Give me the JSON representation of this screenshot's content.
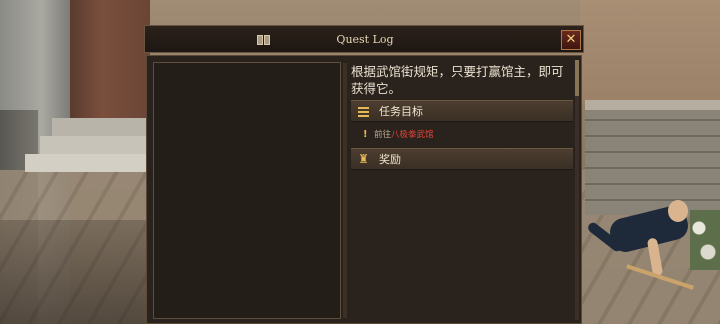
{
  "window": {
    "title": "Quest Log"
  },
  "quest": {
    "description": "根据武馆街规矩，只要打赢馆主，即可获得它。",
    "sections": {
      "objectives_label": "任务目标",
      "rewards_label": "奖励"
    },
    "objectives": [
      {
        "prefix": "前往",
        "target": "八极拳武馆"
      }
    ]
  },
  "colors": {
    "accent_gold": "#e6b956",
    "objective_target_red": "#e2463a",
    "panel_bg": "#2a221c"
  },
  "icons": {
    "title": "book-icon",
    "close": "close-icon",
    "objectives": "list-icon",
    "objective_item": "exclamation-icon",
    "rewards": "trophy-icon"
  }
}
